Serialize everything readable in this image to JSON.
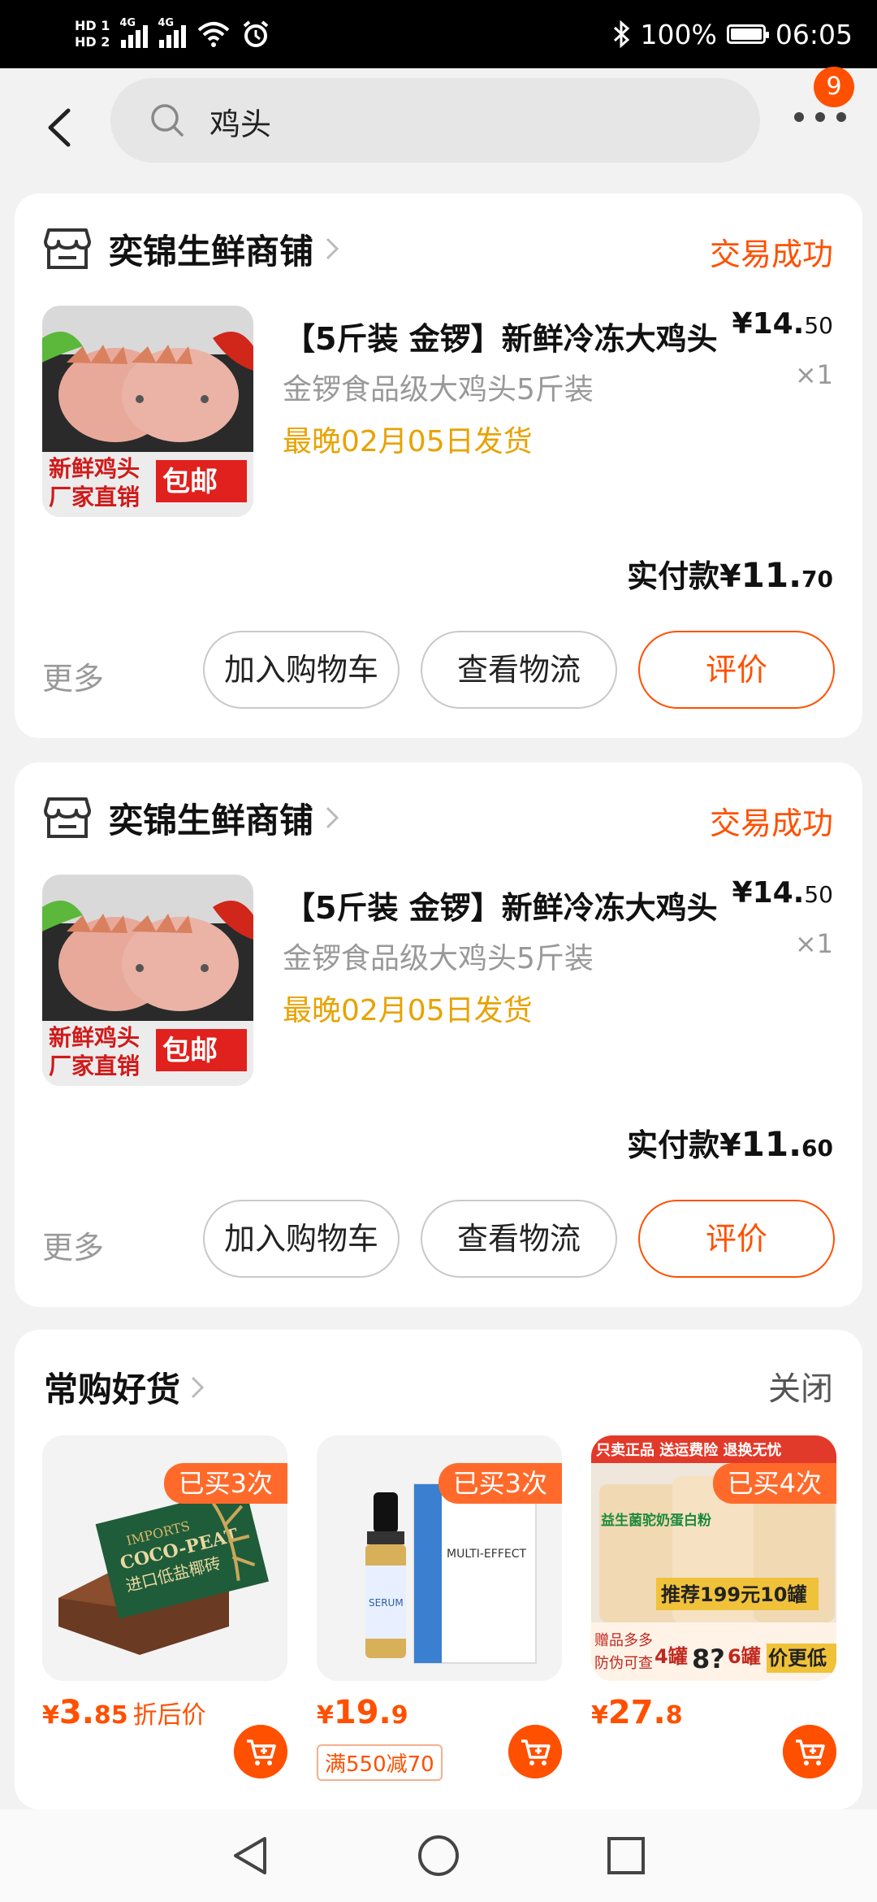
{
  "status_bar": {
    "sim1": "HD 1",
    "sim2": "HD 2",
    "net1": "4G",
    "net2": "4G",
    "battery": "100%",
    "time": "06:05"
  },
  "header": {
    "search_text": "鸡头",
    "badge_count": "9"
  },
  "orders": [
    {
      "shop_name": "奕锦生鲜商铺",
      "status": "交易成功",
      "image_text_1": "新鲜鸡头",
      "image_text_2": "厂家直销",
      "image_tag": "包邮",
      "title": "【5斤装 金锣】新鲜冷冻大鸡头",
      "spec": "金锣食品级大鸡头5斤装",
      "ship": "最晚02月05日发货",
      "price_main": "¥14.",
      "price_dec": "50",
      "qty": "×1",
      "paid_label": "实付款¥",
      "paid_main": "11.",
      "paid_dec": "70",
      "more": "更多",
      "btn_cart": "加入购物车",
      "btn_logistics": "查看物流",
      "btn_rate": "评价"
    },
    {
      "shop_name": "奕锦生鲜商铺",
      "status": "交易成功",
      "image_text_1": "新鲜鸡头",
      "image_text_2": "厂家直销",
      "image_tag": "包邮",
      "title": "【5斤装 金锣】新鲜冷冻大鸡头",
      "spec": "金锣食品级大鸡头5斤装",
      "ship": "最晚02月05日发货",
      "price_main": "¥14.",
      "price_dec": "50",
      "qty": "×1",
      "paid_label": "实付款¥",
      "paid_main": "11.",
      "paid_dec": "60",
      "more": "更多",
      "btn_cart": "加入购物车",
      "btn_logistics": "查看物流",
      "btn_rate": "评价"
    }
  ],
  "recommend": {
    "title": "常购好货",
    "close": "关闭",
    "items": [
      {
        "bought": "已买3次",
        "price_symbol": "¥",
        "price_main": "3.",
        "price_dec": "85",
        "price_tag": "折后价",
        "image_text_1": "IMPORTS",
        "image_text_2": "COCO-PEAT",
        "image_text_3": "进口低盐椰砖"
      },
      {
        "bought": "已买3次",
        "price_symbol": "¥",
        "price_main": "19.",
        "price_dec": "9",
        "coupon": "满550减70",
        "image_text_1": "MULTI-EFFECT",
        "image_text_2": "SERUM"
      },
      {
        "bought": "已买4次",
        "price_symbol": "¥",
        "price_main": "27.",
        "price_dec": "8",
        "image_text_1": "只卖正品 送运费险 退换无忧",
        "image_text_2": "益生菌驼奶蛋白粉",
        "image_text_3": "推荐199元10罐",
        "image_text_4": "赠品多多",
        "image_text_5": "防伪可查",
        "image_text_6": "4罐",
        "image_text_7": "8?",
        "image_text_8": "6罐",
        "image_text_9": "价更低"
      }
    ]
  }
}
